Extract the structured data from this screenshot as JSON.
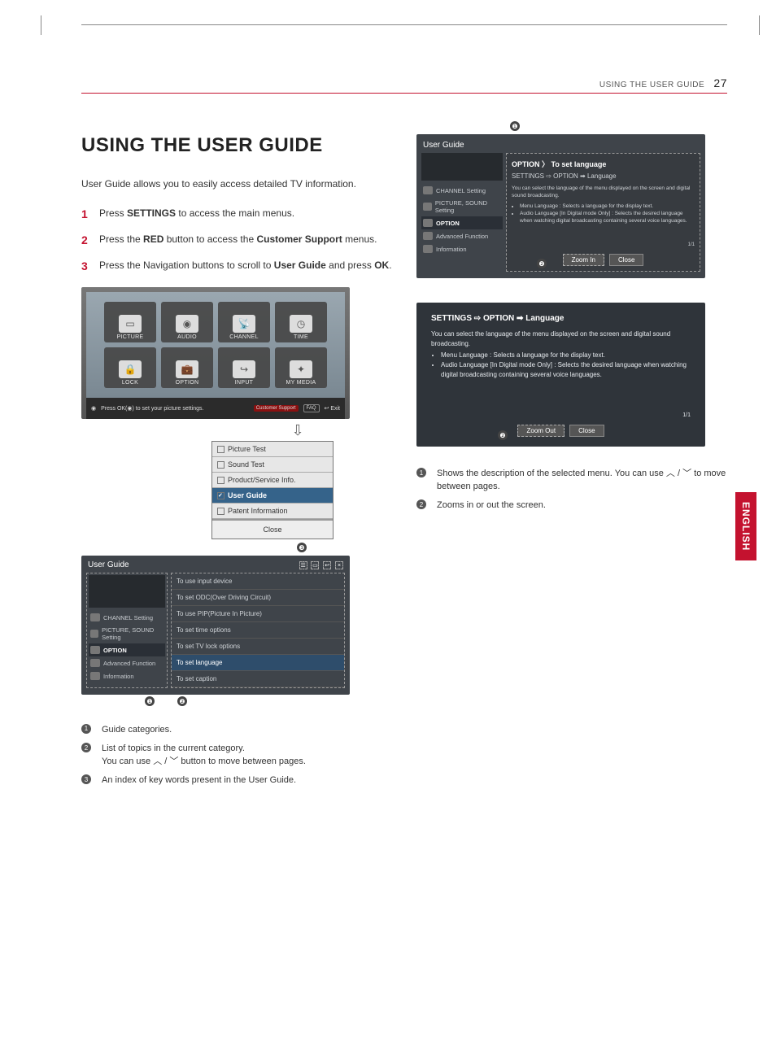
{
  "header": {
    "section": "USING THE USER GUIDE",
    "page_number": "27"
  },
  "title": "USING THE USER GUIDE",
  "intro": "User Guide allows you to easily access detailed TV information.",
  "steps": [
    {
      "pre": "Press ",
      "bold": "SETTINGS",
      "post": " to access the main menus."
    },
    {
      "pre": "Press the ",
      "bold": "RED",
      "mid": " button to access the ",
      "bold2": "Customer Support",
      "post": " menus."
    },
    {
      "pre": "Press the Navigation buttons to scroll to ",
      "bold": "User Guide",
      "mid": " and press ",
      "bold2": "OK",
      "post": "."
    }
  ],
  "tv_menu": {
    "icons": [
      "PICTURE",
      "AUDIO",
      "CHANNEL",
      "TIME",
      "LOCK",
      "OPTION",
      "INPUT",
      "MY MEDIA"
    ],
    "footer_hint": "Press OK(◉) to set your picture settings.",
    "footer_cs": "Customer Support",
    "footer_faq": "FAQ",
    "footer_exit": "Exit"
  },
  "cs_menu": {
    "items": [
      "Picture Test",
      "Sound Test",
      "Product/Service Info.",
      "User Guide",
      "Patent Information"
    ],
    "selected_index": 3,
    "close": "Close"
  },
  "ug_categories": {
    "title": "User Guide",
    "side": [
      "CHANNEL Setting",
      "PICTURE, SOUND Setting",
      "OPTION",
      "Advanced Function",
      "Information"
    ],
    "active_side_index": 2,
    "topics": [
      "To use input device",
      "To set ODC(Over Driving Circuit)",
      "To use PIP(Picture In Picture)",
      "To set time options",
      "To set TV lock options",
      "To set language",
      "To set caption"
    ],
    "selected_topic_index": 5
  },
  "left_callouts": [
    "Guide categories.",
    "List of topics in the current category.\nYou can use ︿ / ﹀ button to move between pages.",
    "An index of key words present in the User Guide."
  ],
  "detail_panel": {
    "title": "User Guide",
    "panel_title": "OPTION 〉 To set language",
    "path": "SETTINGS ⇨ OPTION ➡ Language",
    "side": [
      "CHANNEL Setting",
      "PICTURE, SOUND Setting",
      "OPTION",
      "Advanced Function",
      "Information"
    ],
    "desc": "You can select the language of the menu displayed on the screen and digital sound broadcasting.",
    "bullets": [
      "Menu Language : Selects a language for the display text.",
      "Audio Language [In Digital mode Only] : Selects the desired language when watching digital broadcasting containing several voice languages."
    ],
    "zoom_in": "Zoom In",
    "close": "Close",
    "page_indicator": "1/1"
  },
  "zoomed_panel": {
    "path": "SETTINGS ⇨ OPTION ➡ Language",
    "desc": "You can select the language of the menu displayed on the screen and digital sound broadcasting.",
    "bullets": [
      "Menu Language : Selects a language for the display text.",
      "Audio Language [In Digital mode Only] : Selects the desired language when watching digital broadcasting containing several voice languages."
    ],
    "zoom_out": "Zoom Out",
    "close": "Close",
    "page_indicator": "1/1"
  },
  "right_callouts": [
    "Shows the description of the selected menu. You can use ︿ / ﹀ to move between pages.",
    "Zooms in or out the screen."
  ],
  "lang_tab": "ENGLISH"
}
